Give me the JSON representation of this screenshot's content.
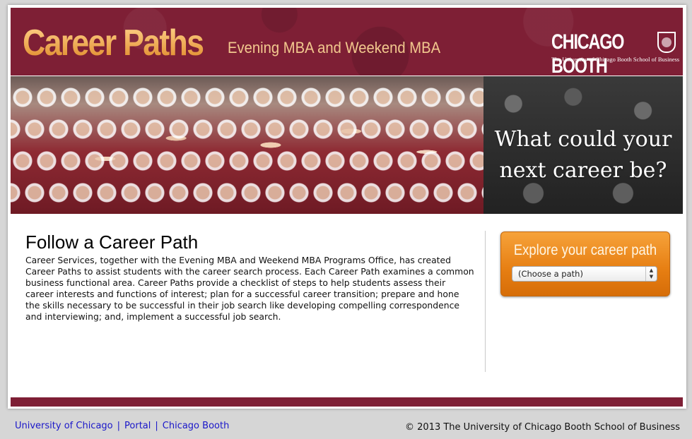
{
  "header": {
    "title": "Career Paths",
    "subtitle": "Evening MBA and Weekend MBA",
    "logo_word": "CHICAGO BOOTH",
    "logo_tagline": "The University of Chicago Booth School of Business"
  },
  "hero": {
    "question_line1": "What could your",
    "question_line2": "next career be?"
  },
  "main": {
    "heading": "Follow a Career Path",
    "body": "Career Services, together with the Evening MBA and Weekend MBA Programs Office, has created Career Paths to assist students with the career search process. Each Career Path examines a common business functional area. Career Paths provide a checklist of steps to help students assess their career interests and functions of interest; plan for a successful career transition; prepare and hone the skills necessary to be successful in their job search like developing compelling correspondence and interviewing; and, implement a successful job search."
  },
  "explore": {
    "label": "Explore your career path",
    "select_value": "(Choose a path)"
  },
  "footer": {
    "links": [
      "University of Chicago",
      "Portal",
      "Chicago Booth"
    ],
    "separator": "|",
    "copyright": "© 2013 The University of Chicago Booth School of Business"
  },
  "colors": {
    "brand_maroon": "#7e1f35",
    "accent_orange": "#e67e12",
    "link_blue": "#1a17c9"
  }
}
